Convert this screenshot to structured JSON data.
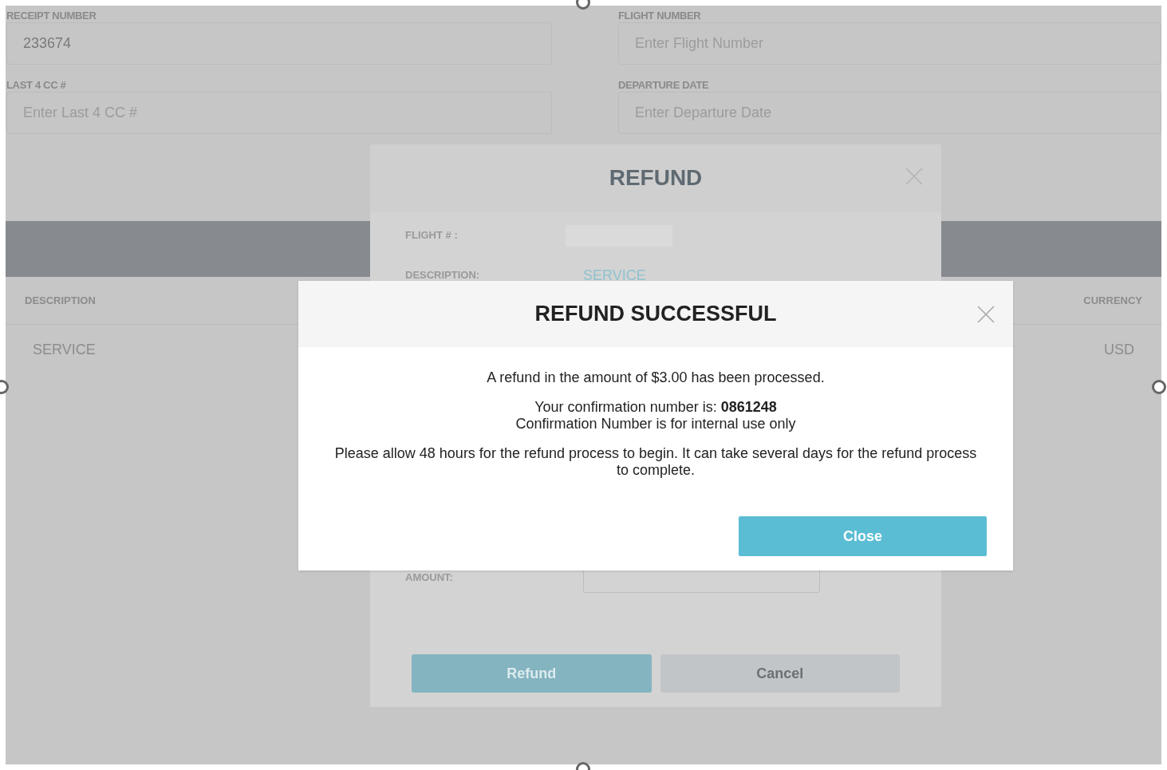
{
  "form": {
    "fields": [
      {
        "label": "RECEIPT NUMBER",
        "value": "233674"
      },
      {
        "label": "FLIGHT NUMBER",
        "placeholder": "Enter Flight Number"
      },
      {
        "label": "LAST 4 CC #",
        "placeholder": "Enter Last 4 CC #"
      },
      {
        "label": "DEPARTURE DATE",
        "placeholder": "Enter Departure Date"
      }
    ]
  },
  "table": {
    "columns": [
      "DESCRIPTION",
      "CURRENCY"
    ],
    "rows": [
      [
        "SERVICE",
        "USD"
      ]
    ]
  },
  "refund_dialog": {
    "title": "REFUND",
    "rows": [
      {
        "kind": "field",
        "label": "FLIGHT # :"
      },
      {
        "kind": "text",
        "label": "DESCRIPTION:",
        "value": "SERVICE"
      },
      {
        "kind": "field",
        "label": "AMOUNT:"
      }
    ],
    "buttons": [
      {
        "label": "Refund",
        "kind": "primary"
      },
      {
        "label": "Cancel",
        "kind": "secondary"
      }
    ]
  },
  "success_dialog": {
    "title": "REFUND SUCCESSFUL",
    "paragraphs": [
      [
        "A refund in the amount of $3.00 has been processed."
      ],
      [
        "Your confirmation number is: **0861248**",
        "Confirmation Number is for internal use only"
      ],
      [
        "Please allow 48 hours for the refund process to begin. It can take several days for the refund process to complete."
      ]
    ],
    "button": "Close"
  }
}
